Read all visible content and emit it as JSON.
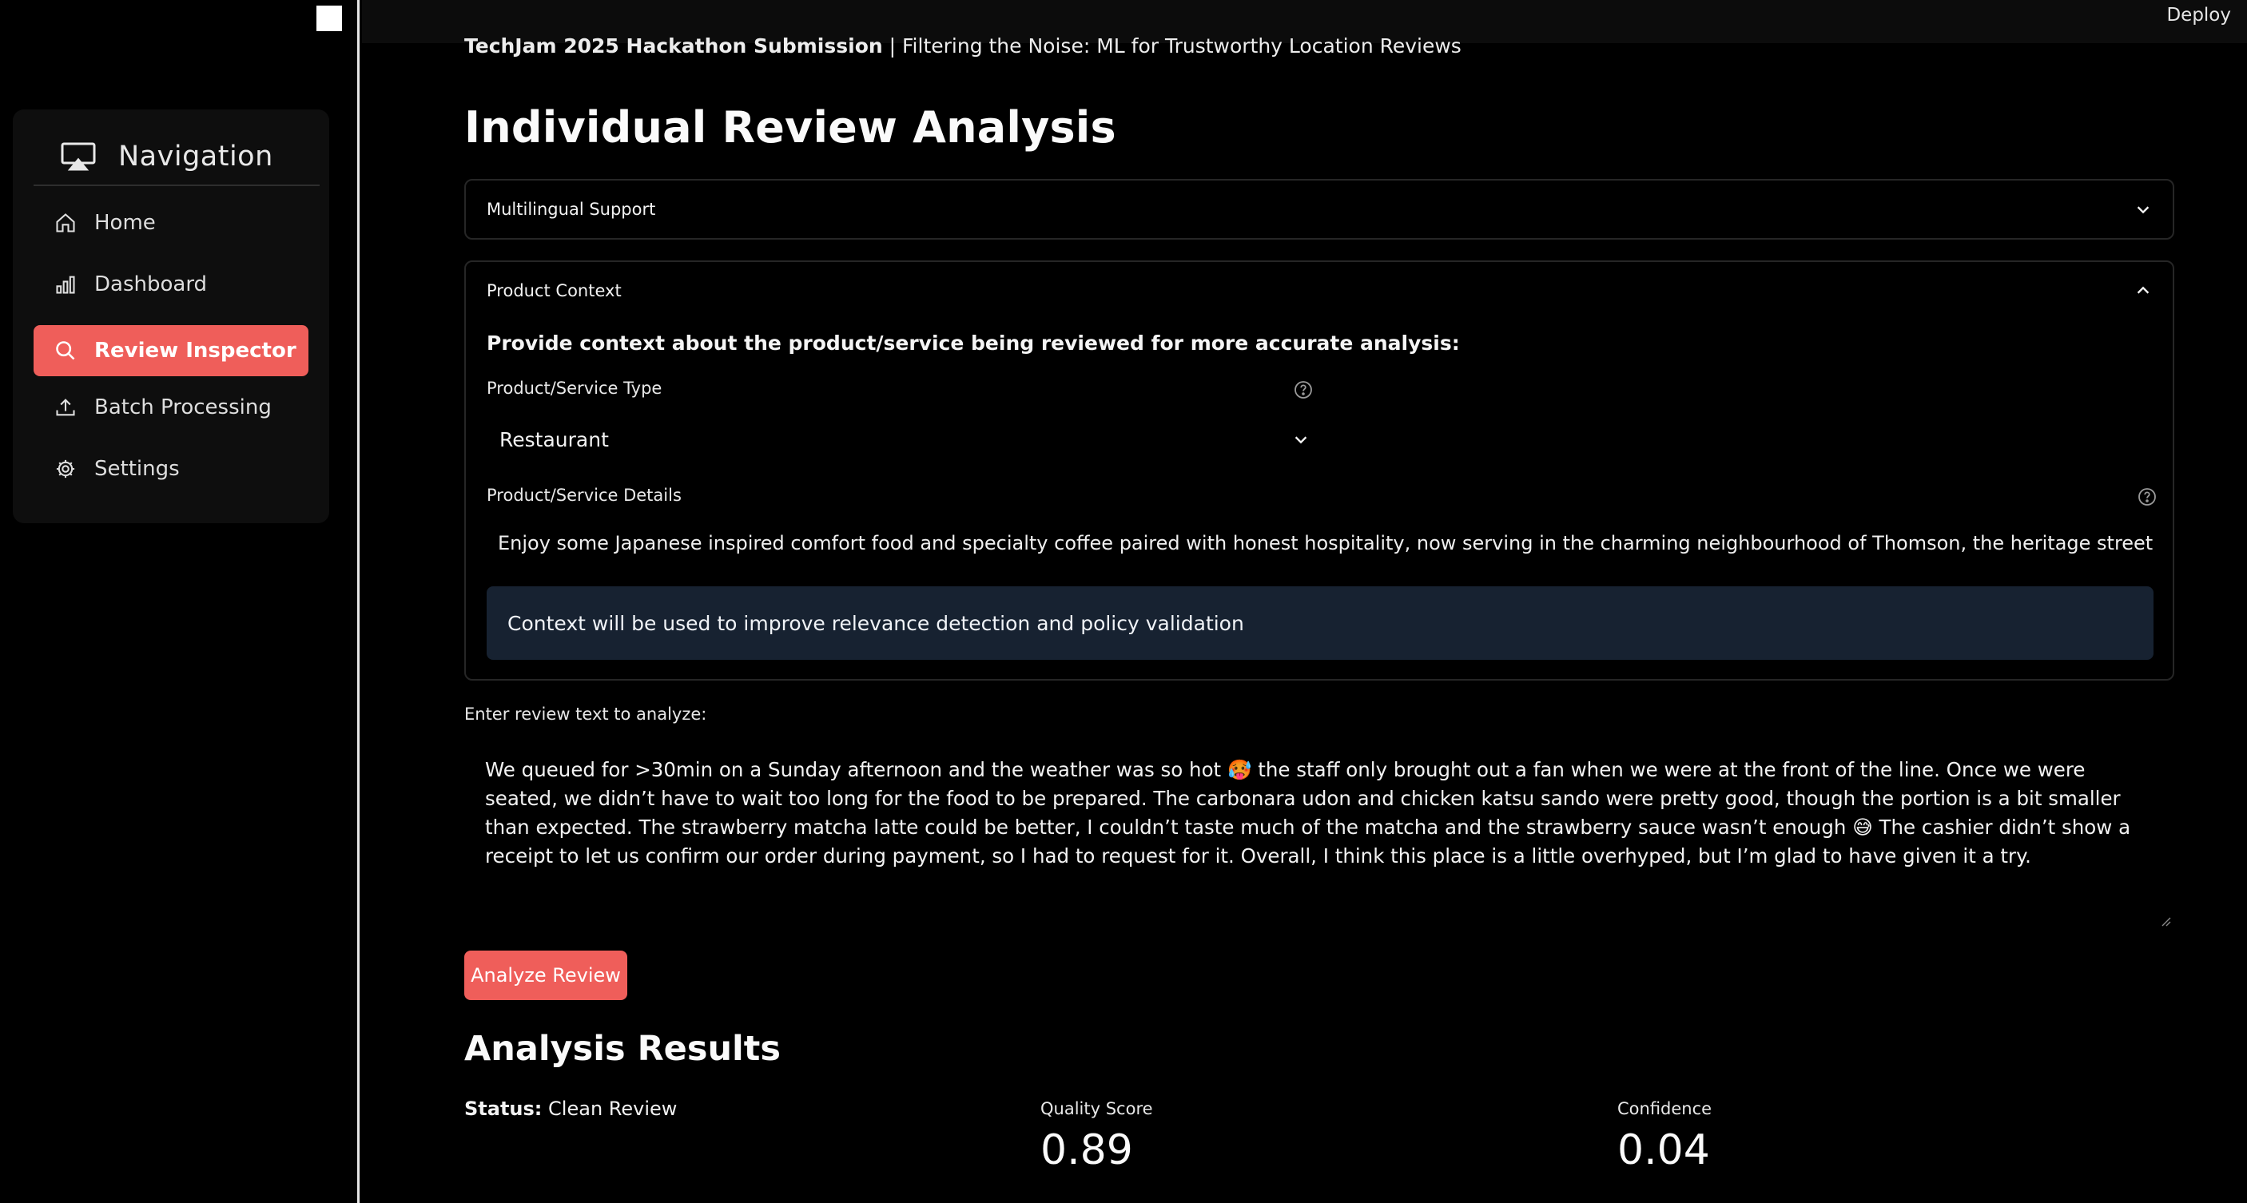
{
  "sidebar": {
    "title": "Navigation",
    "items": [
      {
        "label": "Home",
        "icon": "home-icon"
      },
      {
        "label": "Dashboard",
        "icon": "bar-chart-icon"
      },
      {
        "label": "Review Inspector",
        "icon": "search-icon",
        "active": true
      },
      {
        "label": "Batch Processing",
        "icon": "upload-icon"
      },
      {
        "label": "Settings",
        "icon": "gear-icon"
      }
    ]
  },
  "header": {
    "deploy_label": "Deploy"
  },
  "main": {
    "caption_bold": "TechJam 2025 Hackathon Submission",
    "caption_rest": " | Filtering the Noise: ML for Trustworthy Location Reviews",
    "title": "Individual Review Analysis",
    "multilingual": {
      "label": "Multilingual Support"
    },
    "product_context": {
      "label": "Product Context",
      "intro": "Provide context about the product/service being reviewed for more accurate analysis:",
      "type_label": "Product/Service Type",
      "type_value": "Restaurant",
      "details_label": "Product/Service Details",
      "details_value": "Enjoy some Japanese inspired comfort food and specialty coffee paired with honest hospitality, now serving in the charming neighbourhood of Thomson, the heritage streets of Joo Chiat Road, tl",
      "info": "Context will be used to improve relevance detection and policy validation"
    },
    "review": {
      "label": "Enter review text to analyze:",
      "text": "We queued for >30min on a Sunday afternoon and the weather was so hot 🥵 the staff only brought out a fan when we were at the front of the line. Once we were seated, we didn’t have to wait too long for the food to be prepared. The carbonara udon and chicken katsu sando were pretty good, though the portion is a bit smaller than expected. The strawberry matcha latte could be better, I couldn’t taste much of the matcha and the strawberry sauce wasn’t enough 😅 The cashier didn’t show a receipt to let us confirm our order during payment, so I had to request for it. Overall, I think this place is a little overhyped, but I’m glad to have given it a try."
    },
    "analyze_label": "Analyze Review",
    "results": {
      "title": "Analysis Results",
      "status_label": "Status:",
      "status_value": "Clean Review",
      "quality_label": "Quality Score",
      "quality_value": "0.89",
      "confidence_label": "Confidence",
      "confidence_value": "0.04"
    }
  },
  "colors": {
    "accent": "#ef5e5a",
    "info_bg": "#172231",
    "background": "#000000"
  }
}
